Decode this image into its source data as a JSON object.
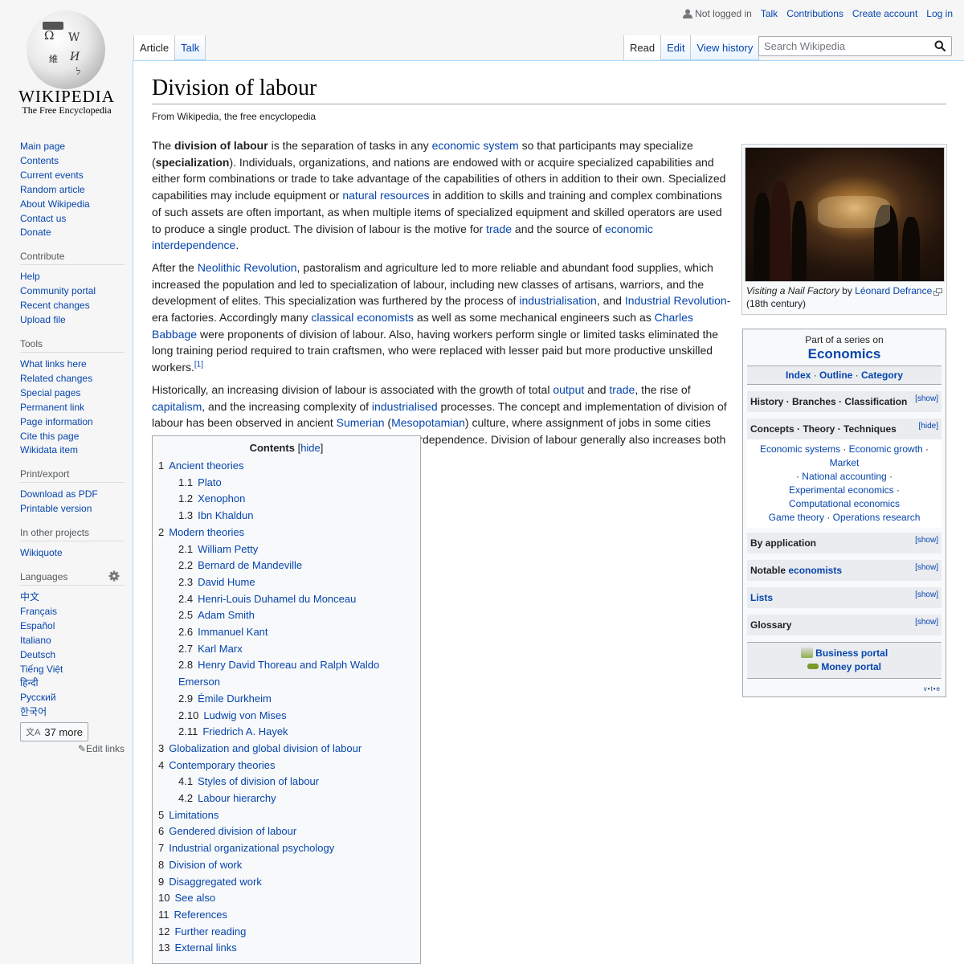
{
  "logo": {
    "wordmark": "WIKIPEDIA",
    "tagline": "The Free Encyclopedia",
    "icon": "wikipedia-globe-logo"
  },
  "personal": {
    "status": "Not logged in",
    "links": [
      "Talk",
      "Contributions",
      "Create account",
      "Log in"
    ]
  },
  "tabs": {
    "namespaces": [
      {
        "label": "Article",
        "selected": true
      },
      {
        "label": "Talk",
        "selected": false
      }
    ],
    "views": [
      {
        "label": "Read",
        "selected": true
      },
      {
        "label": "Edit",
        "selected": false
      },
      {
        "label": "View history",
        "selected": false
      }
    ]
  },
  "search": {
    "placeholder": "Search Wikipedia",
    "value": "",
    "icon": "search-icon"
  },
  "sidebar": {
    "navigation": [
      "Main page",
      "Contents",
      "Current events",
      "Random article",
      "About Wikipedia",
      "Contact us",
      "Donate"
    ],
    "contribute": {
      "heading": "Contribute",
      "items": [
        "Help",
        "Community portal",
        "Recent changes",
        "Upload file"
      ]
    },
    "tools": {
      "heading": "Tools",
      "items": [
        "What links here",
        "Related changes",
        "Special pages",
        "Permanent link",
        "Page information",
        "Cite this page",
        "Wikidata item"
      ]
    },
    "print": {
      "heading": "Print/export",
      "items": [
        "Download as PDF",
        "Printable version"
      ]
    },
    "projects": {
      "heading": "In other projects",
      "items": [
        "Wikiquote"
      ]
    },
    "languages": {
      "heading": "Languages",
      "items": [
        "中文",
        "Français",
        "Español",
        "Italiano",
        "Deutsch",
        "Tiếng Việt",
        "हिन्दी",
        "Русский",
        "한국어"
      ],
      "more": "37 more",
      "edit_links": "Edit links"
    }
  },
  "article": {
    "title": "Division of labour",
    "subtitle": "From Wikipedia, the free encyclopedia",
    "paragraphs": [
      [
        {
          "t": "The "
        },
        {
          "t": "division of labour",
          "b": true
        },
        {
          "t": " is the separation of tasks in any "
        },
        {
          "t": "economic system",
          "l": true
        },
        {
          "t": " so that participants may specialize ("
        },
        {
          "t": "specialization",
          "b": true
        },
        {
          "t": "). Individuals, organizations, and nations are endowed with or acquire specialized capabilities and either form combinations or trade to take advantage of the capabilities of others in addition to their own. Specialized capabilities may include equipment or "
        },
        {
          "t": "natural resources",
          "l": true
        },
        {
          "t": " in addition to skills and training and complex combinations of such assets are often important, as when multiple items of specialized equipment and skilled operators are used to produce a single product. The division of labour is the motive for "
        },
        {
          "t": "trade",
          "l": true
        },
        {
          "t": " and the source of "
        },
        {
          "t": "economic interdependence",
          "l": true
        },
        {
          "t": "."
        }
      ],
      [
        {
          "t": "After the "
        },
        {
          "t": "Neolithic Revolution",
          "l": true
        },
        {
          "t": ", pastoralism and agriculture led to more reliable and abundant food supplies, which increased the population and led to specialization of labour, including new classes of artisans, warriors, and the development of elites. This specialization was furthered by the process of "
        },
        {
          "t": "industrialisation",
          "l": true
        },
        {
          "t": ", and "
        },
        {
          "t": "Industrial Revolution",
          "l": true
        },
        {
          "t": "-era factories. Accordingly many "
        },
        {
          "t": "classical economists",
          "l": true
        },
        {
          "t": " as well as some mechanical engineers such as "
        },
        {
          "t": "Charles Babbage",
          "l": true
        },
        {
          "t": " were proponents of division of labour. Also, having workers perform single or limited tasks eliminated the long training period required to train craftsmen, who were replaced with lesser paid but more productive unskilled workers."
        },
        {
          "t": "[1]",
          "sup": true
        }
      ],
      [
        {
          "t": "Historically, an increasing division of labour is associated with the growth of total "
        },
        {
          "t": "output",
          "l": true
        },
        {
          "t": " and "
        },
        {
          "t": "trade",
          "l": true
        },
        {
          "t": ", the rise of "
        },
        {
          "t": "capitalism",
          "l": true
        },
        {
          "t": ", and the increasing complexity of "
        },
        {
          "t": "industrialised",
          "l": true
        },
        {
          "t": " processes. The concept and implementation of division of labour has been observed in ancient "
        },
        {
          "t": "Sumerian",
          "l": true
        },
        {
          "t": " ("
        },
        {
          "t": "Mesopotamian",
          "l": true
        },
        {
          "t": ") culture, where assignment of jobs in some cities coincided with an increase in trade and economic interdependence. Division of labour generally also increases both producer and individual worker productivity."
        }
      ]
    ]
  },
  "thumbnail": {
    "caption_italic": "Visiting a Nail Factory",
    "caption_by": " by ",
    "caption_link": "Léonard Defrance",
    "caption_rest": "(18th century)",
    "image": "painting-nail-factory"
  },
  "toc": {
    "title": "Contents",
    "toggle": "hide",
    "items": [
      {
        "num": "1",
        "label": "Ancient theories",
        "level": 1
      },
      {
        "num": "1.1",
        "label": "Plato",
        "level": 2
      },
      {
        "num": "1.2",
        "label": "Xenophon",
        "level": 2
      },
      {
        "num": "1.3",
        "label": "Ibn Khaldun",
        "level": 2
      },
      {
        "num": "2",
        "label": "Modern theories",
        "level": 1
      },
      {
        "num": "2.1",
        "label": "William Petty",
        "level": 2
      },
      {
        "num": "2.2",
        "label": "Bernard de Mandeville",
        "level": 2
      },
      {
        "num": "2.3",
        "label": "David Hume",
        "level": 2
      },
      {
        "num": "2.4",
        "label": "Henri-Louis Duhamel du Monceau",
        "level": 2
      },
      {
        "num": "2.5",
        "label": "Adam Smith",
        "level": 2
      },
      {
        "num": "2.6",
        "label": "Immanuel Kant",
        "level": 2
      },
      {
        "num": "2.7",
        "label": "Karl Marx",
        "level": 2
      },
      {
        "num": "2.8",
        "label": "Henry David Thoreau and Ralph Waldo Emerson",
        "level": 2
      },
      {
        "num": "2.9",
        "label": "Émile Durkheim",
        "level": 2
      },
      {
        "num": "2.10",
        "label": "Ludwig von Mises",
        "level": 2
      },
      {
        "num": "2.11",
        "label": "Friedrich A. Hayek",
        "level": 2
      },
      {
        "num": "3",
        "label": "Globalization and global division of labour",
        "level": 1
      },
      {
        "num": "4",
        "label": "Contemporary theories",
        "level": 1
      },
      {
        "num": "4.1",
        "label": "Styles of division of labour",
        "level": 2
      },
      {
        "num": "4.2",
        "label": "Labour hierarchy",
        "level": 2
      },
      {
        "num": "5",
        "label": "Limitations",
        "level": 1
      },
      {
        "num": "6",
        "label": "Gendered division of labour",
        "level": 1
      },
      {
        "num": "7",
        "label": "Industrial organizational psychology",
        "level": 1
      },
      {
        "num": "8",
        "label": "Division of work",
        "level": 1
      },
      {
        "num": "9",
        "label": "Disaggregated work",
        "level": 1
      },
      {
        "num": "10",
        "label": "See also",
        "level": 1
      },
      {
        "num": "11",
        "label": "References",
        "level": 1
      },
      {
        "num": "12",
        "label": "Further reading",
        "level": 1
      },
      {
        "num": "13",
        "label": "External links",
        "level": 1
      }
    ]
  },
  "navbox": {
    "series_label": "Part of a series on",
    "series_title": "Economics",
    "top_links": [
      "Index",
      "Outline",
      "Category"
    ],
    "groups": [
      {
        "title": "History · Branches · Classification",
        "toggle": "[show]"
      },
      {
        "title": "Concepts · Theory · Techniques",
        "toggle": "[hide]",
        "expanded": true,
        "items": [
          "Economic systems",
          "Economic growth",
          "Market",
          "National accounting",
          "Experimental economics",
          "Computational economics",
          "Game theory",
          "Operations research"
        ]
      },
      {
        "title": "By application",
        "toggle": "[show]"
      },
      {
        "title_prefix": "Notable ",
        "title_link": "economists",
        "toggle": "[show]"
      },
      {
        "title_link_only": "Lists",
        "toggle": "[show]"
      },
      {
        "title": "Glossary",
        "toggle": "[show]"
      }
    ],
    "portals": [
      "Business portal",
      "Money portal"
    ],
    "vte": [
      "v",
      "t",
      "e"
    ]
  },
  "colors": {
    "link": "#0645ad",
    "border": "#a7d7f9",
    "text": "#202122"
  }
}
